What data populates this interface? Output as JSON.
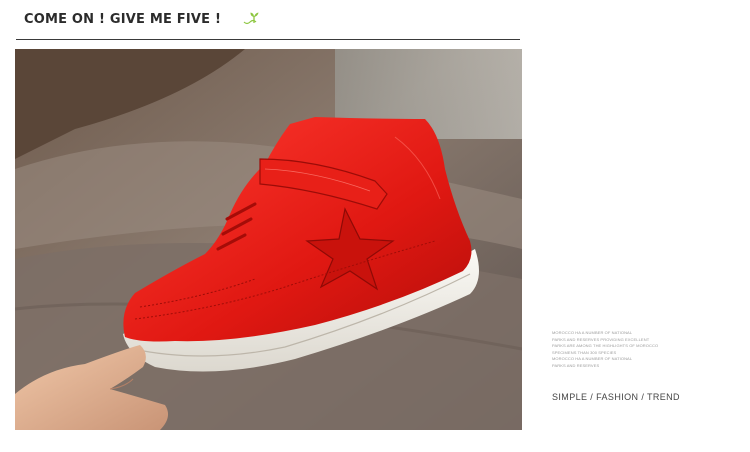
{
  "header": {
    "title": "COME ON ! GIVE ME FIVE !",
    "icon": "sprout-icon",
    "accent_color": "#8cc63f"
  },
  "photo": {
    "subject": "red-high-top-sneaker"
  },
  "side_text": {
    "lines": [
      "MOROCCO HA A NUMBER OF NATIONAL",
      "PARKS AND RESERVES PROVIDING EXCELLENT",
      "PARKS ARE AMONG THE HIGHLIGHTS OF MOROCCO",
      "SPECIMENS THAN 300 SPECIES",
      "MOROCCO HA A NUMBER OF NATIONAL",
      "PARKS AND RESERVES"
    ],
    "tagline": "SIMPLE / FASHION / TREND"
  }
}
